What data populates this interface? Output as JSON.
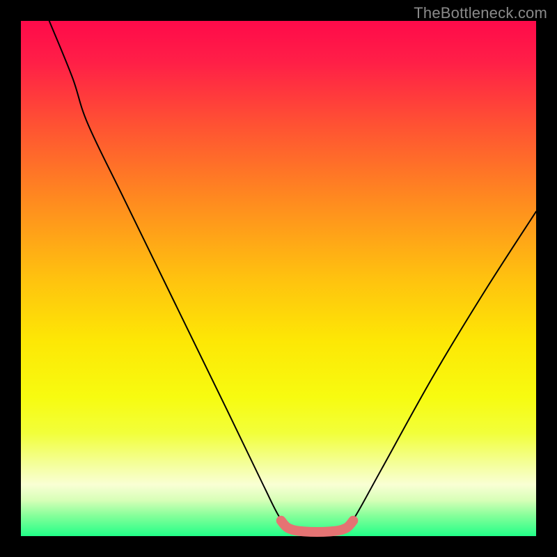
{
  "watermark": "TheBottleneck.com",
  "chart_data": {
    "type": "line",
    "title": "",
    "xlabel": "",
    "ylabel": "",
    "xlim": [
      0,
      100
    ],
    "ylim": [
      0,
      100
    ],
    "background_gradient": {
      "stops": [
        {
          "offset": 0.0,
          "color": "#ff0a4a"
        },
        {
          "offset": 0.08,
          "color": "#ff1f47"
        },
        {
          "offset": 0.2,
          "color": "#ff5133"
        },
        {
          "offset": 0.35,
          "color": "#ff8b1f"
        },
        {
          "offset": 0.5,
          "color": "#ffc20f"
        },
        {
          "offset": 0.62,
          "color": "#fde705"
        },
        {
          "offset": 0.73,
          "color": "#f7fb10"
        },
        {
          "offset": 0.8,
          "color": "#f2ff3a"
        },
        {
          "offset": 0.86,
          "color": "#f4ff9a"
        },
        {
          "offset": 0.9,
          "color": "#f9ffd4"
        },
        {
          "offset": 0.93,
          "color": "#d8ffb8"
        },
        {
          "offset": 0.96,
          "color": "#86ff9a"
        },
        {
          "offset": 1.0,
          "color": "#22ff88"
        }
      ]
    },
    "series": [
      {
        "name": "bottleneck-curve",
        "color": "#000000",
        "stroke_width": 2,
        "points": [
          {
            "x": 5.5,
            "y": 100.0
          },
          {
            "x": 10.0,
            "y": 89.0
          },
          {
            "x": 13.0,
            "y": 80.0
          },
          {
            "x": 20.0,
            "y": 65.5
          },
          {
            "x": 30.0,
            "y": 45.0
          },
          {
            "x": 40.0,
            "y": 24.5
          },
          {
            "x": 47.0,
            "y": 10.0
          },
          {
            "x": 50.0,
            "y": 4.0
          },
          {
            "x": 52.0,
            "y": 1.5
          },
          {
            "x": 55.0,
            "y": 0.7
          },
          {
            "x": 60.0,
            "y": 0.7
          },
          {
            "x": 63.0,
            "y": 1.5
          },
          {
            "x": 65.0,
            "y": 4.0
          },
          {
            "x": 70.0,
            "y": 13.0
          },
          {
            "x": 80.0,
            "y": 31.0
          },
          {
            "x": 90.0,
            "y": 47.5
          },
          {
            "x": 100.0,
            "y": 63.0
          }
        ]
      },
      {
        "name": "highlight-segment",
        "color": "#e57373",
        "stroke_width": 14,
        "points": [
          {
            "x": 50.5,
            "y": 3.0
          },
          {
            "x": 52.0,
            "y": 1.5
          },
          {
            "x": 55.0,
            "y": 0.9
          },
          {
            "x": 60.0,
            "y": 0.9
          },
          {
            "x": 63.0,
            "y": 1.5
          },
          {
            "x": 64.5,
            "y": 3.0
          }
        ]
      }
    ]
  }
}
